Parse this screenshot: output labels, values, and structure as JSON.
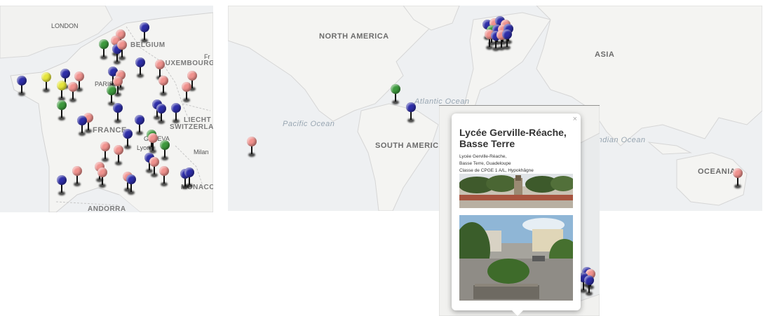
{
  "france_map": {
    "cities": [
      "LONDON",
      "PARIS",
      "GENEVA",
      "Lyon",
      "Milan",
      "Fr"
    ],
    "countries": [
      "BELGIUM",
      "LUXEMBOURG",
      "FRANCE",
      "LIECHT",
      "SWITZERLA",
      "ANDORRA",
      "MONACO"
    ]
  },
  "world_map": {
    "continents": [
      "NORTH AMERICA",
      "ASIA",
      "SOUTH AMERICA",
      "OCEANIA"
    ],
    "oceans": [
      "Pacific Ocean",
      "Atlantic Ocean",
      "Indian Ocean"
    ]
  },
  "popup": {
    "close": "×",
    "title": "Lycée Gerville-Réache, Basse Terre",
    "desc_line1": "Lycée Gerville-Réache,",
    "desc_line2": "Basse Terre, Guadeloupe",
    "desc_line3": "Classe de CPGE 1 A/L, Hypokhâgne"
  },
  "pin_colors": {
    "blue": "#2e2ea8",
    "pink": "#f0928e",
    "green": "#3d9a3d",
    "yellow": "#e6e63c"
  }
}
